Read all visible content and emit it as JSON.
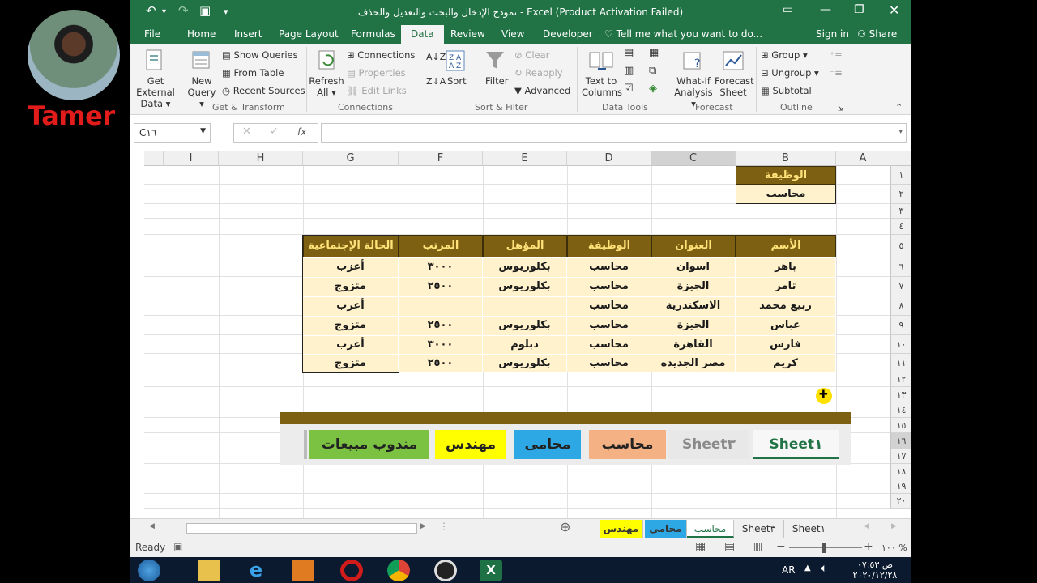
{
  "presenter": {
    "name": "Tamer"
  },
  "window": {
    "title": "نموذج الإدخال والبحث والتعديل والحذف - Excel (Product Activation Failed)"
  },
  "ribbon_tabs": [
    "File",
    "Home",
    "Insert",
    "Page Layout",
    "Formulas",
    "Data",
    "Review",
    "View",
    "Developer"
  ],
  "active_tab": "Data",
  "tell_me": "Tell me what you want to do...",
  "sign_in": "Sign in",
  "share": "Share",
  "ribbon": {
    "get_external": [
      "Get External",
      "Data ▾"
    ],
    "new_query": [
      "New",
      "Query ▾"
    ],
    "show_queries": "Show Queries",
    "from_table": "From Table",
    "recent_sources": "Recent Sources",
    "refresh_all": [
      "Refresh",
      "All ▾"
    ],
    "connections": "Connections",
    "properties": "Properties",
    "edit_links": "Edit Links",
    "sort": "Sort",
    "filter": "Filter",
    "clear": "Clear",
    "reapply": "Reapply",
    "advanced": "Advanced",
    "text_to_columns": [
      "Text to",
      "Columns"
    ],
    "what_if": [
      "What-If",
      "Analysis ▾"
    ],
    "forecast_sheet": [
      "Forecast",
      "Sheet"
    ],
    "group": "Group",
    "ungroup": "Ungroup",
    "subtotal": "Subtotal",
    "groups": {
      "get_transform": "Get & Transform",
      "connections": "Connections",
      "sort_filter": "Sort & Filter",
      "data_tools": "Data Tools",
      "forecast": "Forecast",
      "outline": "Outline"
    }
  },
  "formula_bar": {
    "name_box": "C١٦",
    "formula": ""
  },
  "columns": [
    "I",
    "H",
    "G",
    "F",
    "E",
    "D",
    "C",
    "B",
    "A"
  ],
  "rows": [
    "١",
    "٢",
    "٣",
    "٤",
    "٥",
    "٦",
    "٧",
    "٨",
    "٩",
    "١٠",
    "١١",
    "١٢",
    "١٣",
    "١٤",
    "١٥",
    "١٦",
    "١٧",
    "١٨",
    "١٩",
    "٢٠"
  ],
  "lookup": {
    "header": "الوظيفة",
    "value": "محاسب"
  },
  "table": {
    "headers": [
      "الأسم",
      "العنوان",
      "الوظيفة",
      "المؤهل",
      "المرتب",
      "الحالة الإجتماعية"
    ],
    "rows": [
      [
        "باهر",
        "اسوان",
        "محاسب",
        "بكلوريوس",
        "٣٠٠٠",
        "أعزب"
      ],
      [
        "تامر",
        "الجيزة",
        "محاسب",
        "بكلوريوس",
        "٢٥٠٠",
        "متزوج"
      ],
      [
        "ربيع محمد",
        "الاسكندرية",
        "محاسب",
        "",
        "",
        "أعزب"
      ],
      [
        "عباس",
        "الجيزة",
        "محاسب",
        "بكلوريوس",
        "٢٥٠٠",
        "متزوج"
      ],
      [
        "فارس",
        "القاهرة",
        "محاسب",
        "دبلوم",
        "٣٠٠٠",
        "أعزب"
      ],
      [
        "كريم",
        "مصر الجديده",
        "محاسب",
        "بكلوريوس",
        "٢٥٠٠",
        "متزوج"
      ]
    ]
  },
  "nav_buttons": [
    {
      "label": "Sheet١",
      "color": "#f7f7f7"
    },
    {
      "label": "Sheet٣",
      "color": "#e8e8e8"
    },
    {
      "label": "محاسب",
      "color": "#f4b183"
    },
    {
      "label": "محامى",
      "color": "#2ea8e5"
    },
    {
      "label": "مهندس",
      "color": "#ffff00"
    },
    {
      "label": "مندوب مبيعات",
      "color": "#7cc242"
    }
  ],
  "sheet_tabs": [
    {
      "label": "مهندس",
      "color": "#ffff00"
    },
    {
      "label": "محامى",
      "color": "#2ea8e5"
    },
    {
      "label": "محاسب",
      "color": "#ffffff"
    },
    {
      "label": "Sheet٣",
      "color": "#f0f0f0"
    },
    {
      "label": "Sheet١",
      "color": "#f0f0f0"
    }
  ],
  "status": {
    "ready": "Ready",
    "zoom": "١٠٠ %"
  },
  "taskbar": {
    "lang": "AR",
    "time": "ص ٠٧:٥٣",
    "date": "٢٠٢٠/١٢/٢٨"
  }
}
